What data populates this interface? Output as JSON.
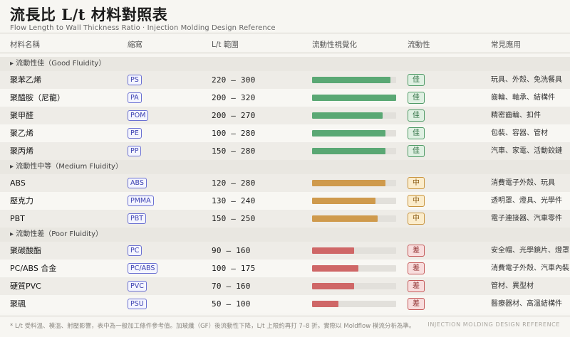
{
  "header": {
    "title": "流長比 L/t  材料對照表",
    "subtitle": "Flow Length to Wall Thickness Ratio · Injection Molding Design Reference"
  },
  "columns": {
    "material": "材料名稱",
    "abbr": "縮寫",
    "range": "L/t 範圍",
    "visual": "流動性視覺化",
    "fluidity": "流動性",
    "applications": "常見應用"
  },
  "colors": {
    "good_fill": "#5aa874",
    "good_badge_bg": "#dff0e2",
    "good_badge_border": "#4f9a66",
    "good_badge_text": "#2f6f43",
    "medium_fill": "#cf9a4c",
    "medium_badge_bg": "#fbeccb",
    "medium_badge_border": "#c9953f",
    "medium_badge_text": "#8a5a12",
    "poor_fill": "#cf6767",
    "poor_badge_bg": "#f8dddd",
    "poor_badge_border": "#c55a5a",
    "poor_badge_text": "#8e2d2d"
  },
  "groups": [
    {
      "label": "▸ 流動性佳（Good Fluidity）",
      "level": "good",
      "rows": [
        {
          "name": "聚苯乙烯",
          "abbr": "PS",
          "range": "220 — 300",
          "fluidity_index": 0.93,
          "badge": "佳",
          "applications": "玩具、外殼、免洗餐具"
        },
        {
          "name": "聚醯胺（尼龍）",
          "abbr": "PA",
          "range": "200 — 320",
          "fluidity_index": 1.0,
          "badge": "佳",
          "applications": "齒輪、軸承、結構件"
        },
        {
          "name": "聚甲醛",
          "abbr": "POM",
          "range": "200 — 270",
          "fluidity_index": 0.84,
          "badge": "佳",
          "applications": "精密齒輪、扣件"
        },
        {
          "name": "聚乙烯",
          "abbr": "PE",
          "range": "100 — 280",
          "fluidity_index": 0.87,
          "badge": "佳",
          "applications": "包裝、容器、管材"
        },
        {
          "name": "聚丙烯",
          "abbr": "PP",
          "range": "150 — 280",
          "fluidity_index": 0.87,
          "badge": "佳",
          "applications": "汽車、家電、活動鉸鏈"
        }
      ]
    },
    {
      "label": "▸ 流動性中等（Medium Fluidity）",
      "level": "medium",
      "rows": [
        {
          "name": "ABS",
          "abbr": "ABS",
          "range": "120 — 280",
          "fluidity_index": 0.87,
          "badge": "中",
          "applications": "消費電子外殼、玩具"
        },
        {
          "name": "壓克力",
          "abbr": "PMMA",
          "range": "130 — 240",
          "fluidity_index": 0.75,
          "badge": "中",
          "applications": "透明罩、燈具、光學件"
        },
        {
          "name": "PBT",
          "abbr": "PBT",
          "range": "150 — 250",
          "fluidity_index": 0.78,
          "badge": "中",
          "applications": "電子連接器、汽車零件"
        }
      ]
    },
    {
      "label": "▸ 流動性差（Poor Fluidity）",
      "level": "poor",
      "rows": [
        {
          "name": "聚碳酸酯",
          "abbr": "PC",
          "range": "90 — 160",
          "fluidity_index": 0.5,
          "badge": "差",
          "applications": "安全帽、光學鏡片、燈罩"
        },
        {
          "name": "PC/ABS 合金",
          "abbr": "PC/ABS",
          "range": "100 — 175",
          "fluidity_index": 0.55,
          "badge": "差",
          "applications": "消費電子外殼、汽車內裝"
        },
        {
          "name": "硬質PVC",
          "abbr": "PVC",
          "range": "70 — 160",
          "fluidity_index": 0.5,
          "badge": "差",
          "applications": "管材、異型材"
        },
        {
          "name": "聚碸",
          "abbr": "PSU",
          "range": "50 — 100",
          "fluidity_index": 0.31,
          "badge": "差",
          "applications": "醫療器材、高溫結構件"
        }
      ]
    }
  ],
  "footer": {
    "note": "* L/t 受料溫、模溫、射壓影響，表中為一般加工條件參考值。加玻纖（GF）後流動性下降，L/t 上限約再打 7–8 折。實際以 Moldflow 模流分析為準。",
    "tag": "INJECTION MOLDING DESIGN REFERENCE"
  }
}
